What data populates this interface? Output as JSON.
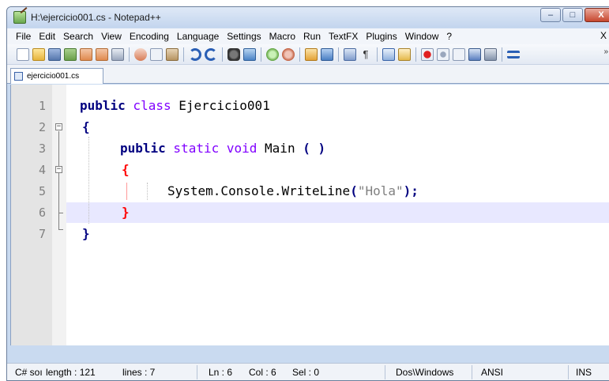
{
  "window": {
    "title": "H:\\ejercicio001.cs - Notepad++",
    "minimize": "–",
    "maximize": "□",
    "close": "X"
  },
  "menu": {
    "items": [
      "File",
      "Edit",
      "Search",
      "View",
      "Encoding",
      "Language",
      "Settings",
      "Macro",
      "Run",
      "TextFX",
      "Plugins",
      "Window",
      "?"
    ],
    "close_doc": "X"
  },
  "toolbar": {
    "more": "»"
  },
  "tabs": [
    {
      "label": "ejercicio001.cs"
    }
  ],
  "editor": {
    "lines": [
      {
        "number": "1"
      },
      {
        "number": "2"
      },
      {
        "number": "3"
      },
      {
        "number": "4"
      },
      {
        "number": "5"
      },
      {
        "number": "6"
      },
      {
        "number": "7"
      }
    ],
    "tokens": {
      "l1_public": "public",
      "l1_class": " class",
      "l1_name": " Ejercicio001",
      "l2_brace": "{",
      "l3_public": "public",
      "l3_static": " static",
      "l3_void": " void",
      "l3_main": " Main",
      "l3_parens": "( )",
      "l4_brace": "{",
      "l5_call": "System.Console.WriteLine",
      "l5_open": "(",
      "l5_str": "\"Hola\"",
      "l5_close": ");",
      "l6_brace": "}",
      "l7_brace": "}"
    },
    "current_line": 6
  },
  "status": {
    "lang": "C# soı",
    "length": "length : 121",
    "lines": "lines : 7",
    "ln": "Ln : 6",
    "col": "Col : 6",
    "sel": "Sel : 0",
    "eol": "Dos\\Windows",
    "encoding": "ANSI",
    "mode": "INS"
  }
}
